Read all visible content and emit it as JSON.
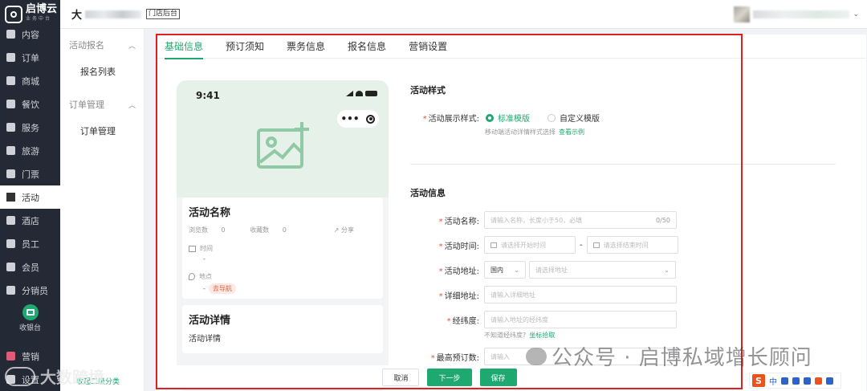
{
  "brand": {
    "name": "启博云",
    "sub": "业务中台"
  },
  "sidebar": {
    "items": [
      {
        "label": "内容",
        "icon": "layers-icon"
      },
      {
        "label": "订单",
        "icon": "document-icon"
      },
      {
        "label": "商城",
        "icon": "shop-icon"
      },
      {
        "label": "餐饮",
        "icon": "dining-icon"
      },
      {
        "label": "服务",
        "icon": "heart-icon"
      },
      {
        "label": "旅游",
        "icon": "travel-icon"
      },
      {
        "label": "门票",
        "icon": "ticket-icon"
      },
      {
        "label": "活动",
        "icon": "flag-icon"
      },
      {
        "label": "酒店",
        "icon": "hotel-icon"
      },
      {
        "label": "员工",
        "icon": "staff-icon"
      },
      {
        "label": "会员",
        "icon": "member-icon"
      },
      {
        "label": "分销员",
        "icon": "distributor-icon"
      }
    ],
    "active": "活动",
    "cashier": "收银台",
    "bottom": [
      {
        "label": "营销",
        "icon": "marketing-icon"
      },
      {
        "label": "设置",
        "icon": "settings-icon"
      }
    ]
  },
  "topbar": {
    "store_initial": "大",
    "store_tag": "门店后台"
  },
  "submenu": {
    "groups": [
      {
        "title": "活动报名",
        "items": [
          "报名列表"
        ]
      },
      {
        "title": "订单管理",
        "items": [
          "订单管理"
        ]
      }
    ]
  },
  "tabs": [
    "基础信息",
    "预订须知",
    "票务信息",
    "报名信息",
    "营销设置"
  ],
  "active_tab": "基础信息",
  "preview": {
    "time": "9:41",
    "title": "活动名称",
    "views_label": "浏览数",
    "views": "0",
    "favs_label": "收藏数",
    "favs": "0",
    "share": "分享",
    "time_label": "时间",
    "time_value": "-",
    "place_label": "地点",
    "place_value": "-",
    "nav_button": "去导航",
    "detail_title": "活动详情",
    "detail_text": "活动详情"
  },
  "form": {
    "style_section": "活动样式",
    "display_label": "活动展示样式:",
    "option_standard": "标准模版",
    "option_custom": "自定义模版",
    "display_hint": "移动端活动详情样式选择",
    "display_hint_link": "查看示例",
    "info_section": "活动信息",
    "name_label": "活动名称:",
    "name_placeholder": "请输入名称，长度小于50，必填",
    "name_count": "0/50",
    "time_label": "活动时间:",
    "start_placeholder": "请选择开始时间",
    "time_sep": "-",
    "end_placeholder": "请选择结束时间",
    "address_label": "活动地址:",
    "region_value": "国内",
    "address_placeholder": "请选择地址",
    "detail_label": "详细地址:",
    "detail_placeholder": "请输入详细地址",
    "latlng_label": "经纬度:",
    "latlng_placeholder": "请输入地址的经纬度",
    "latlng_hint": "不知道经纬度?",
    "latlng_link": "坐标拾取",
    "max_label": "最高预订数:",
    "max_placeholder": "请输入"
  },
  "actions": {
    "cancel": "取消",
    "next": "下一步",
    "save": "保存"
  },
  "submenu_bottom": "收起二级分类",
  "watermark": "公众号 · 启博私域增长顾问",
  "watermark2": "大数跨境",
  "ime": {
    "lang": "中"
  },
  "colors": {
    "accent": "#1fa870",
    "sidebar_bg": "#232a35",
    "required": "#e4523f",
    "frame": "#e02020"
  }
}
